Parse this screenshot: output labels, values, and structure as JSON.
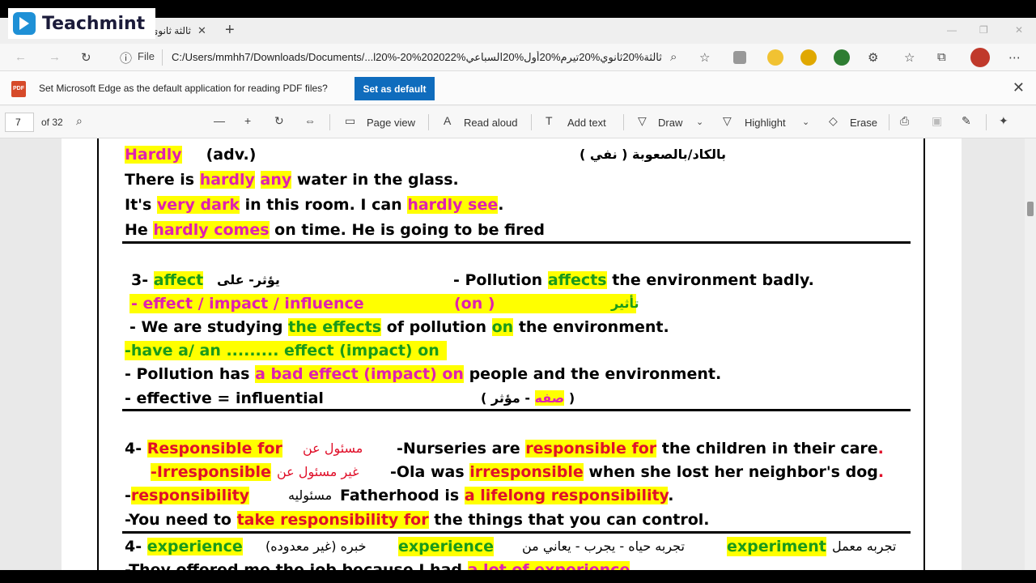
{
  "logo": {
    "text": "Teachmint"
  },
  "tab": {
    "title": "ثالثة ثانوي",
    "close": "✕",
    "new_tab": "+"
  },
  "addressbar": {
    "info": "ⓘ",
    "file_label": "File",
    "url": "C:/Users/mmhh7/Downloads/Documents/...l20%-20%202022%ثالثة%20ثانوي%20تيرم%20أول%20السباعي"
  },
  "infobar": {
    "message": "Set Microsoft Edge as the default application for reading PDF files?",
    "button": "Set as default",
    "badge": "PDF"
  },
  "pdfbar": {
    "page": "7",
    "of": "of 32",
    "page_view": "Page view",
    "read_aloud": "Read aloud",
    "add_text": "Add text",
    "draw": "Draw",
    "highlight": "Highlight",
    "erase": "Erase"
  },
  "content": {
    "hardly_word": "Hardly",
    "hardly_pos": "(adv.)",
    "hardly_ar": "بالكاد/بالصعوبة ( نفي )",
    "s1a": "There is ",
    "s1b": "hardly",
    "s1c": " ",
    "s1d": "any",
    "s1e": " water in the glass.",
    "s2a": "It's ",
    "s2b": "very dark",
    "s2c": " in this room. I can ",
    "s2d": "hardly see",
    "s2e": ".",
    "s3a": "He ",
    "s3b": "hardly comes",
    "s3c": " on time. He is going to be fired",
    "aff_num": "3-",
    "aff_word": "affect",
    "aff_ar": "يؤثر- على",
    "aff_ex_a": "- Pollution ",
    "aff_ex_b": "affects",
    "aff_ex_c": " the environment badly.",
    "eff_a": "- effect / impact / influence",
    "eff_b": "(on   )",
    "eff_ar": "تأثير",
    "st_a": " - We are studying ",
    "st_b": "the effects",
    "st_c": " of pollution ",
    "st_d": "on",
    "st_e": " the environment.",
    "have": "-have a/ an ......... effect (impact) on",
    "pol_a": "- Pollution has ",
    "pol_b": "a",
    "pol_c": " bad effect",
    "pol_d": " (impact) ",
    "pol_e": "on",
    "pol_f": " people and the environment.",
    "effv_a": "- effective = influential",
    "effv_b": "( ",
    "effv_c": "صفه",
    "effv_d": " -  مؤثر  )",
    "resp_num": "4-",
    "resp_word": "Responsible for",
    "resp_ar": "مسئول عن",
    "resp_ex_a": "-Nurseries are ",
    "resp_ex_b": "responsible for",
    "resp_ex_c": " the children in their care",
    "resp_ex_d": ".",
    "irr_word": "-Irresponsible",
    "irr_ar": "غير مسئول عن",
    "irr_ex_a": "-Ola was ",
    "irr_ex_b": "irresponsible",
    "irr_ex_c": " when she lost her neighbor's dog",
    "irr_ex_d": ".",
    "rs_a": "-",
    "rs_b": "responsibility",
    "rs_ar": "مسئوليه",
    "rs_c": " Fatherhood is ",
    "rs_d": "a lifelong responsibility",
    "rs_e": ".",
    "you_a": "-You need to ",
    "you_b": "take responsibility for",
    "you_c": " the things that you can control.",
    "exp_num": "4-",
    "exp_word": "experience",
    "exp_ar1": "خبره (غير معدوده)",
    "exp_word2": "experience",
    "exp_ar2": "تجربه حياه - يجرب - يعاني من",
    "exp_word3": "experiment",
    "exp_ar3": "تجربه معمل",
    "last_a": "-They offered me the job because I had ",
    "last_b": "a lot of experience"
  },
  "colors": {
    "pink": "#e020b0",
    "green": "#1a9a1a",
    "red": "#e0102a",
    "yellow": "#ffff00",
    "accent": "#0f6cbd"
  }
}
